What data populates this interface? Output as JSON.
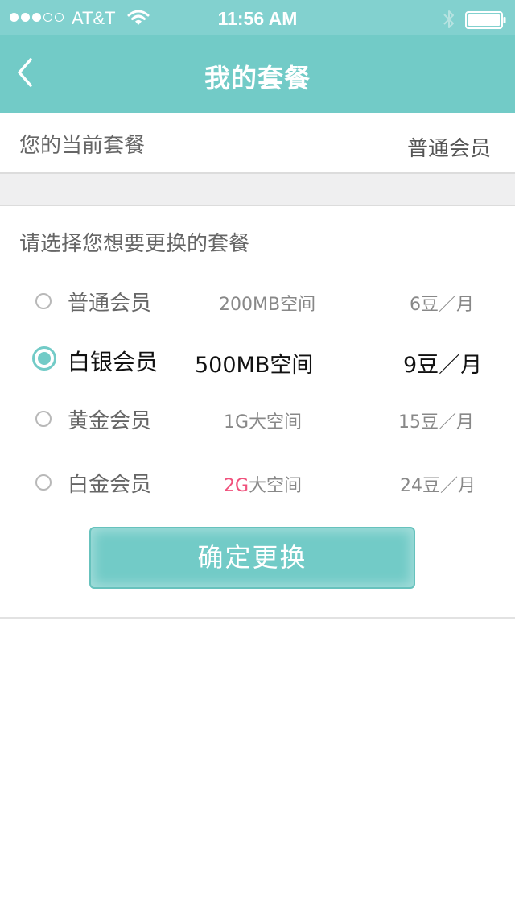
{
  "status_bar": {
    "carrier": "AT&T",
    "time": "11:56 AM",
    "signal_bars_filled": 3,
    "signal_bars_total": 5,
    "icons": [
      "wifi-icon",
      "bluetooth-icon",
      "battery-icon"
    ]
  },
  "nav": {
    "title": "我的套餐",
    "back_icon": "chevron-left-icon"
  },
  "current_plan": {
    "label": "您的当前套餐",
    "value": "普通会员"
  },
  "selection": {
    "heading": "请选择您想要更换的套餐",
    "selected_index": 1,
    "options": [
      {
        "name": "普通会员",
        "storage_highlight": "",
        "storage": "200MB空间",
        "price": "6豆／月",
        "selected": false
      },
      {
        "name": "白银会员",
        "storage_highlight": "",
        "storage": "500MB空间",
        "price": "9豆／月",
        "selected": true
      },
      {
        "name": "黄金会员",
        "storage_highlight": "",
        "storage": "1G大空间",
        "price": "15豆／月",
        "selected": false
      },
      {
        "name": "白金会员",
        "storage_highlight": "2G",
        "storage": "大空间",
        "price": "24豆／月",
        "selected": false
      }
    ]
  },
  "confirm_button": {
    "label": "确定更换"
  },
  "colors": {
    "status_bar": "#82d1cf",
    "nav_bar": "#72cbc7",
    "accent": "#72cbc7",
    "highlight": "#f0517c",
    "divider": "#dcdcdc",
    "gap_background": "#efeff0"
  }
}
